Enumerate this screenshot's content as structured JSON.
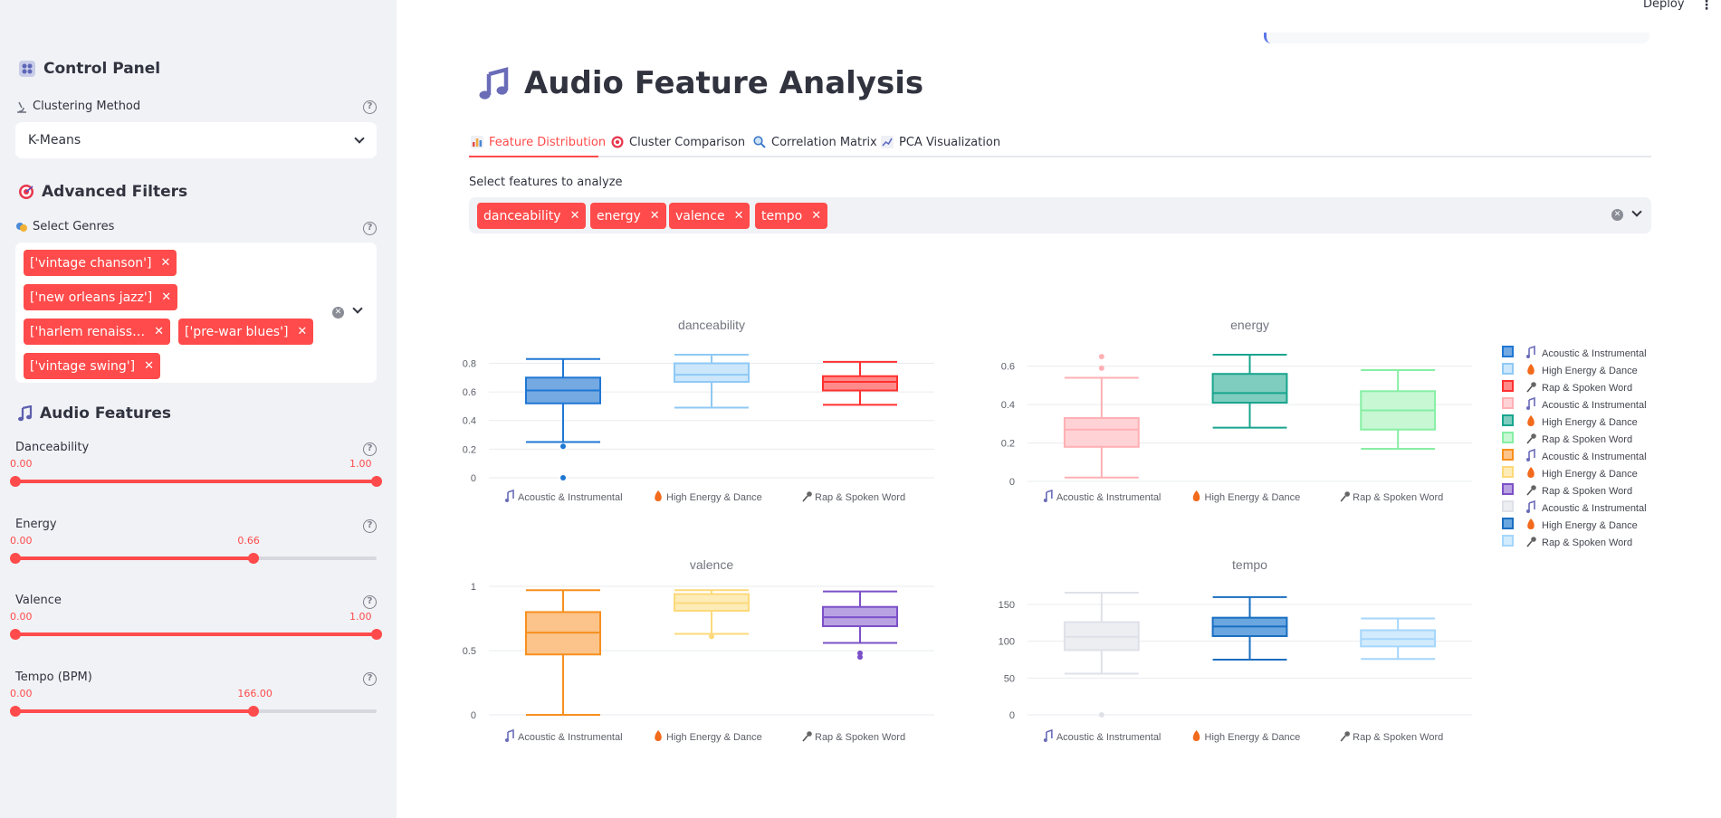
{
  "sidebar": {
    "control_panel_title": "Control Panel",
    "clustering": {
      "label": "Clustering Method",
      "value": "K-Means"
    },
    "advanced_filters_title": "Advanced Filters",
    "genres": {
      "label": "Select Genres",
      "tags": [
        "['vintage chanson']",
        "['new orleans jazz']",
        "['harlem renaiss…",
        "['pre-war blues']",
        "['vintage swing']"
      ]
    },
    "audio_features_title": "Audio Features",
    "sliders": [
      {
        "label": "Danceability",
        "min_label": "0.00",
        "max_label": "1.00",
        "low": 0.0,
        "high": 1.0
      },
      {
        "label": "Energy",
        "min_label": "0.00",
        "max_label": "0.66",
        "low": 0.0,
        "high": 0.66
      },
      {
        "label": "Valence",
        "min_label": "0.00",
        "max_label": "1.00",
        "low": 0.0,
        "high": 1.0
      },
      {
        "label": "Tempo (BPM)",
        "min_label": "0.00",
        "max_label": "166.00",
        "low": 0.0,
        "high": 0.66
      }
    ]
  },
  "header": {
    "deploy_label": "Deploy",
    "menu_glyph": "⋮"
  },
  "main": {
    "title": "Audio Feature Analysis",
    "tabs": [
      {
        "label": "Feature Distribution",
        "icon": "bar-chart-icon"
      },
      {
        "label": "Cluster Comparison",
        "icon": "target-icon"
      },
      {
        "label": "Correlation Matrix",
        "icon": "magnifier-icon"
      },
      {
        "label": "PCA Visualization",
        "icon": "line-chart-icon"
      }
    ],
    "features_label": "Select features to analyze",
    "feature_tags": [
      "danceability",
      "energy",
      "valence",
      "tempo"
    ]
  },
  "chart_data": {
    "type": "box",
    "categories": [
      "Acoustic & Instrumental",
      "High Energy & Dance",
      "Rap & Spoken Word"
    ],
    "subplots": [
      {
        "title": "danceability",
        "yticks": [
          "0",
          "0.2",
          "0.4",
          "0.6",
          "0.8"
        ],
        "ylim": [
          0,
          0.86
        ],
        "boxes": [
          {
            "min": 0.25,
            "q1": 0.52,
            "median": 0.61,
            "q3": 0.7,
            "max": 0.83,
            "outliers": [
              0.22,
              0.0
            ],
            "color": "#1f77d4",
            "fill": "#74a9e2"
          },
          {
            "min": 0.49,
            "q1": 0.67,
            "median": 0.72,
            "q3": 0.8,
            "max": 0.86,
            "outliers": [],
            "color": "#8fc9f5",
            "fill": "#cce7fb"
          },
          {
            "min": 0.51,
            "q1": 0.61,
            "median": 0.67,
            "q3": 0.71,
            "max": 0.81,
            "outliers": [],
            "color": "#ff3030",
            "fill": "#ff8a8a"
          }
        ]
      },
      {
        "title": "energy",
        "yticks": [
          "0",
          "0.2",
          "0.4",
          "0.6"
        ],
        "ylim": [
          0,
          0.66
        ],
        "boxes": [
          {
            "min": 0.02,
            "q1": 0.18,
            "median": 0.27,
            "q3": 0.33,
            "max": 0.54,
            "outliers": [
              0.59,
              0.65
            ],
            "color": "#ffb0b4",
            "fill": "#ffd3d6"
          },
          {
            "min": 0.28,
            "q1": 0.41,
            "median": 0.46,
            "q3": 0.56,
            "max": 0.66,
            "outliers": [],
            "color": "#18a58e",
            "fill": "#7fcdbf"
          },
          {
            "min": 0.17,
            "q1": 0.27,
            "median": 0.37,
            "q3": 0.47,
            "max": 0.58,
            "outliers": [],
            "color": "#86efa4",
            "fill": "#c7f7d3"
          }
        ]
      },
      {
        "title": "valence",
        "yticks": [
          "0",
          "0.5",
          "1"
        ],
        "ylim": [
          0,
          1.0
        ],
        "boxes": [
          {
            "min": 0.0,
            "q1": 0.47,
            "median": 0.64,
            "q3": 0.8,
            "max": 0.97,
            "outliers": [],
            "color": "#f7901e",
            "fill": "#fcc38a"
          },
          {
            "min": 0.63,
            "q1": 0.81,
            "median": 0.87,
            "q3": 0.94,
            "max": 0.97,
            "outliers": [
              0.61
            ],
            "color": "#fcd97a",
            "fill": "#fdebb8"
          },
          {
            "min": 0.56,
            "q1": 0.69,
            "median": 0.76,
            "q3": 0.84,
            "max": 0.96,
            "outliers": [
              0.48,
              0.45
            ],
            "color": "#7b50c8",
            "fill": "#b9a2e2"
          }
        ]
      },
      {
        "title": "tempo",
        "yticks": [
          "0",
          "50",
          "100",
          "150"
        ],
        "ylim": [
          0,
          166
        ],
        "boxes": [
          {
            "min": 56,
            "q1": 88,
            "median": 106,
            "q3": 126,
            "max": 166,
            "outliers": [
              0
            ],
            "color": "#dfe1e8",
            "fill": "#eceef2"
          },
          {
            "min": 75,
            "q1": 107,
            "median": 120,
            "q3": 132,
            "max": 160,
            "outliers": [],
            "color": "#1a6ec0",
            "fill": "#6aa7e0"
          },
          {
            "min": 76,
            "q1": 93,
            "median": 103,
            "q3": 115,
            "max": 131,
            "outliers": [],
            "color": "#a5d6fb",
            "fill": "#d2ebfd"
          }
        ]
      }
    ],
    "legend": [
      {
        "label": "Acoustic & Instrumental",
        "color": "#1f77d4",
        "fill": "#74a9e2"
      },
      {
        "label": "High Energy & Dance",
        "color": "#8fc9f5",
        "fill": "#cce7fb"
      },
      {
        "label": "Rap & Spoken Word",
        "color": "#ff3030",
        "fill": "#ff8a8a"
      },
      {
        "label": "Acoustic & Instrumental",
        "color": "#ffb0b4",
        "fill": "#ffd3d6"
      },
      {
        "label": "High Energy & Dance",
        "color": "#18a58e",
        "fill": "#7fcdbf"
      },
      {
        "label": "Rap & Spoken Word",
        "color": "#86efa4",
        "fill": "#c7f7d3"
      },
      {
        "label": "Acoustic & Instrumental",
        "color": "#f7901e",
        "fill": "#fcc38a"
      },
      {
        "label": "High Energy & Dance",
        "color": "#fcd97a",
        "fill": "#fdebb8"
      },
      {
        "label": "Rap & Spoken Word",
        "color": "#7b50c8",
        "fill": "#b9a2e2"
      },
      {
        "label": "Acoustic & Instrumental",
        "color": "#dfe1e8",
        "fill": "#eceef2"
      },
      {
        "label": "High Energy & Dance",
        "color": "#1a6ec0",
        "fill": "#6aa7e0"
      },
      {
        "label": "Rap & Spoken Word",
        "color": "#a5d6fb",
        "fill": "#d2ebfd"
      }
    ]
  }
}
